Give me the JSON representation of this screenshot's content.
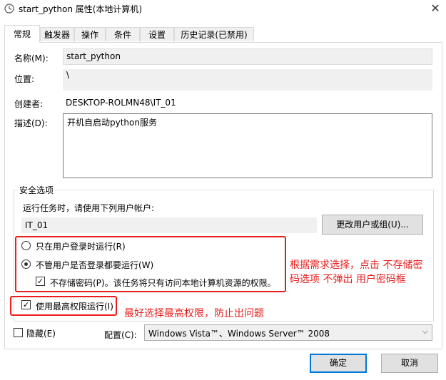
{
  "window": {
    "title": "start_python 属性(本地计算机)",
    "title_icon": "clock-task-icon",
    "close_glyph": "✕"
  },
  "tabs": [
    {
      "label": "常规"
    },
    {
      "label": "触发器"
    },
    {
      "label": "操作"
    },
    {
      "label": "条件"
    },
    {
      "label": "设置"
    },
    {
      "label": "历史记录(已禁用)"
    }
  ],
  "general": {
    "name_label": "名称(M):",
    "name_value": "start_python",
    "location_label": "位置:",
    "location_value": "\\",
    "author_label": "创建者:",
    "author_value": "DESKTOP-ROLMN48\\IT_01",
    "desc_label": "描述(D):",
    "desc_value": "开机自启动python服务"
  },
  "security": {
    "group_title": "安全选项",
    "run_as_label": "运行任务时，请使用下列用户帐户:",
    "user_value": "IT_01",
    "change_user_button": "更改用户或组(U)...",
    "radio_logged_on": "只在用户登录时运行(R)",
    "radio_whether": "不管用户是否登录都要运行(W)",
    "no_store_pw": "不存储密码(P)。该任务将只有访问本地计算机资源的权限。",
    "highest_priv": "使用最高权限运行(I)"
  },
  "bottom": {
    "hidden_label": "隐藏(E)",
    "config_label": "配置(C):",
    "config_value": "Windows Vista™、Windows Server™ 2008",
    "ok_button": "确定",
    "cancel_button": "取消"
  },
  "annotations": {
    "note1_line1": "根据需求选择，点击 不存储密",
    "note1_line2": "码选项 不弹出 用户密码框",
    "note2": "最好选择最高权限，防止出问题",
    "color": "#e81e1e"
  }
}
